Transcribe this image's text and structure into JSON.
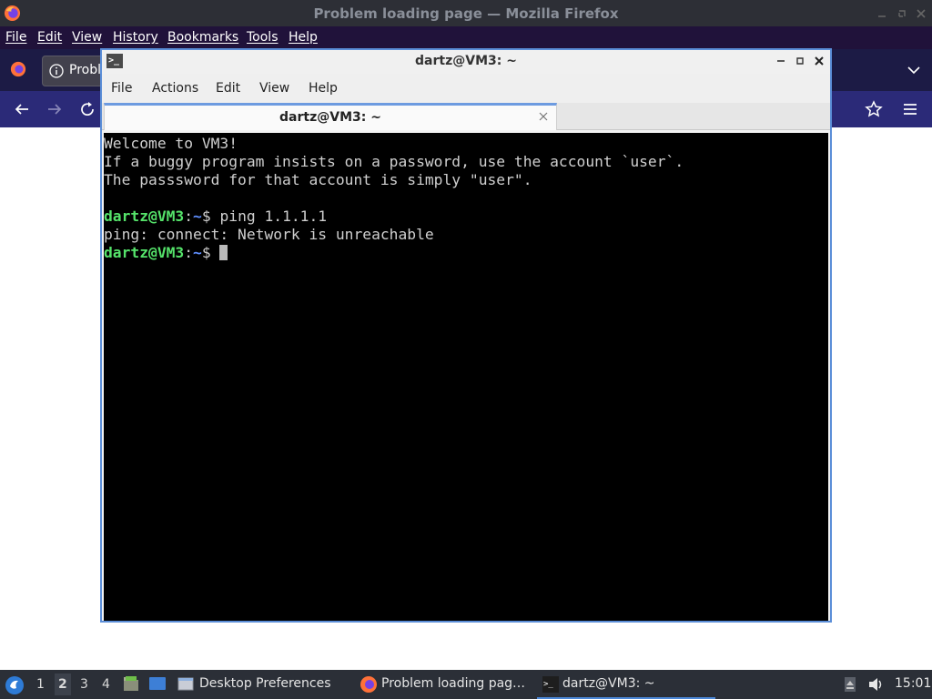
{
  "firefox": {
    "window_title": "Problem loading page — Mozilla Firefox",
    "menu": [
      "File",
      "Edit",
      "View",
      "History",
      "Bookmarks",
      "Tools",
      "Help"
    ],
    "tab_label": "Probl",
    "icons": {
      "logo": "firefox-logo-icon",
      "back": "back-arrow-icon",
      "forward": "forward-arrow-icon",
      "reload": "reload-icon",
      "bookmark": "star-icon",
      "menu": "hamburger-menu-icon",
      "tab_list": "chevron-down-icon"
    },
    "colors": {
      "menubar": "#20123a",
      "tabstrip": "#1c1b45",
      "navbar": "#2b2a78"
    }
  },
  "terminal": {
    "window_title": "dartz@VM3: ~",
    "menu": [
      "File",
      "Actions",
      "Edit",
      "View",
      "Help"
    ],
    "tab_label": "dartz@VM3: ~",
    "lines": {
      "l1": "Welcome to VM3!",
      "l2": "If a buggy program insists on a password, use the account `user`.",
      "l3": "The passsword for that account is simply \"user\".",
      "l5_user": "dartz@VM3",
      "l5_sep": ":",
      "l5_path": "~",
      "l5_cmd": "$ ping 1.1.1.1",
      "l6": "ping: connect: Network is unreachable",
      "l7_user": "dartz@VM3",
      "l7_sep": ":",
      "l7_path": "~",
      "l7_cmd": "$ "
    },
    "colors": {
      "prompt_user": "#55e36a",
      "prompt_path": "#5f8fff",
      "text": "#cfcfcf",
      "background": "#000000"
    }
  },
  "taskbar": {
    "workspaces": [
      "1",
      "2",
      "3",
      "4"
    ],
    "active_workspace": "2",
    "tasks": [
      {
        "label": "Desktop Preferences",
        "icon": "desktop-preferences-icon"
      },
      {
        "label": "Problem loading pag…",
        "icon": "firefox-logo-icon"
      },
      {
        "label": "dartz@VM3: ~",
        "icon": "terminal-icon"
      }
    ],
    "clock": "15:01"
  }
}
